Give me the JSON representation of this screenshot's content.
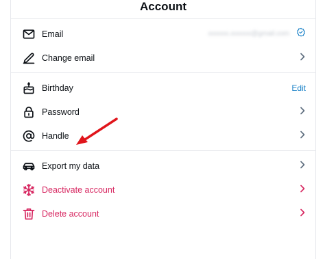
{
  "header": {
    "title": "Account"
  },
  "sections": {
    "contact": {
      "email_label": "Email",
      "email_value": "xxxxxx.xxxxxx@gmail.com",
      "change_email_label": "Change email"
    },
    "profile": {
      "birthday_label": "Birthday",
      "birthday_action": "Edit",
      "password_label": "Password",
      "handle_label": "Handle"
    },
    "data": {
      "export_label": "Export my data",
      "deactivate_label": "Deactivate account",
      "delete_label": "Delete account"
    }
  },
  "icons": {
    "email": "envelope-icon",
    "change_email": "pencil-icon",
    "verified": "verified-badge-icon",
    "birthday": "cake-icon",
    "password": "lock-icon",
    "handle": "at-sign-icon",
    "export": "car-icon",
    "deactivate": "snowflake-icon",
    "delete": "trash-icon",
    "chevron": "chevron-right-icon"
  },
  "colors": {
    "text": "#0b0f14",
    "divider": "#e6e8ec",
    "link": "#1d83c8",
    "danger": "#d72660",
    "chevron": "#5b6b7c",
    "annotation": "#e0151b"
  }
}
